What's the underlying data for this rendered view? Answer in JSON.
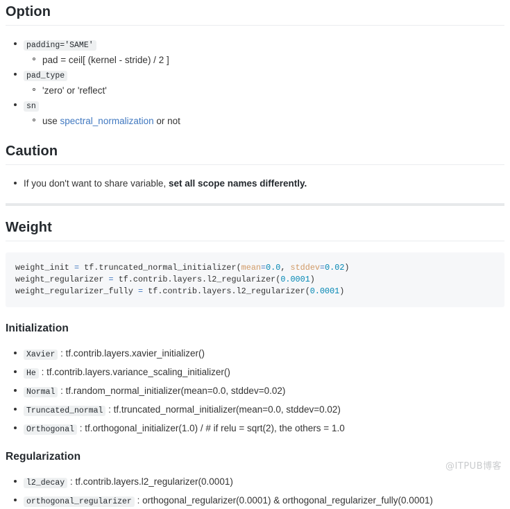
{
  "sections": {
    "option": {
      "heading": "Option",
      "items": [
        {
          "code": "padding='SAME'",
          "sub": [
            {
              "pre": "pad = ceil[ (kernel - stride) / 2 ]"
            }
          ]
        },
        {
          "code": "pad_type",
          "sub": [
            {
              "pre": "'zero' or 'reflect'"
            }
          ]
        },
        {
          "code": "sn",
          "sub": [
            {
              "pre": "use ",
              "link": "spectral_normalization",
              "post": " or not"
            }
          ]
        }
      ]
    },
    "caution": {
      "heading": "Caution",
      "items": [
        {
          "plain": "If you don't want to share variable, ",
          "bold": "set all scope names differently."
        }
      ]
    },
    "weight": {
      "heading": "Weight",
      "code_lines": [
        {
          "segments": [
            {
              "t": "weight_init ",
              "c": "plain"
            },
            {
              "t": "=",
              "c": "op"
            },
            {
              "t": " tf.truncated_normal_initializer(",
              "c": "plain"
            },
            {
              "t": "mean",
              "c": "par"
            },
            {
              "t": "=",
              "c": "op"
            },
            {
              "t": "0.0",
              "c": "num"
            },
            {
              "t": ", ",
              "c": "plain"
            },
            {
              "t": "stddev",
              "c": "par"
            },
            {
              "t": "=",
              "c": "op"
            },
            {
              "t": "0.02",
              "c": "num"
            },
            {
              "t": ")",
              "c": "plain"
            }
          ]
        },
        {
          "segments": [
            {
              "t": "weight_regularizer ",
              "c": "plain"
            },
            {
              "t": "=",
              "c": "op"
            },
            {
              "t": " tf.contrib.layers.l2_regularizer(",
              "c": "plain"
            },
            {
              "t": "0.0001",
              "c": "num"
            },
            {
              "t": ")",
              "c": "plain"
            }
          ]
        },
        {
          "segments": [
            {
              "t": "weight_regularizer_fully ",
              "c": "plain"
            },
            {
              "t": "=",
              "c": "op"
            },
            {
              "t": " tf.contrib.layers.l2_regularizer(",
              "c": "plain"
            },
            {
              "t": "0.0001",
              "c": "num"
            },
            {
              "t": ")",
              "c": "plain"
            }
          ]
        }
      ]
    },
    "initialization": {
      "heading": "Initialization",
      "items": [
        {
          "code": "Xavier",
          "text": " : tf.contrib.layers.xavier_initializer()"
        },
        {
          "code": "He",
          "text": " : tf.contrib.layers.variance_scaling_initializer()"
        },
        {
          "code": "Normal",
          "text": " : tf.random_normal_initializer(mean=0.0, stddev=0.02)"
        },
        {
          "code": "Truncated_normal",
          "text": " : tf.truncated_normal_initializer(mean=0.0, stddev=0.02)"
        },
        {
          "code": "Orthogonal",
          "text": " : tf.orthogonal_initializer(1.0) / # if relu = sqrt(2), the others = 1.0"
        }
      ]
    },
    "regularization": {
      "heading": "Regularization",
      "items": [
        {
          "code": "l2_decay",
          "text": " : tf.contrib.layers.l2_regularizer(0.0001)"
        },
        {
          "code": "orthogonal_regularizer",
          "text": " : orthogonal_regularizer(0.0001) & orthogonal_regularizer_fully(0.0001)"
        }
      ]
    }
  },
  "watermark": "@ITPUB博客",
  "colors": {
    "link": "#4078c0",
    "heading": "#24292e",
    "body": "#333333",
    "code_bg": "#f6f7f9",
    "inline_code_bg": "#eef0f1",
    "rule": "#e7e9eb",
    "heading_border": "#eaecef",
    "token_number": "#0086b3",
    "token_param": "#d19a66",
    "token_operator": "#4078c0"
  }
}
